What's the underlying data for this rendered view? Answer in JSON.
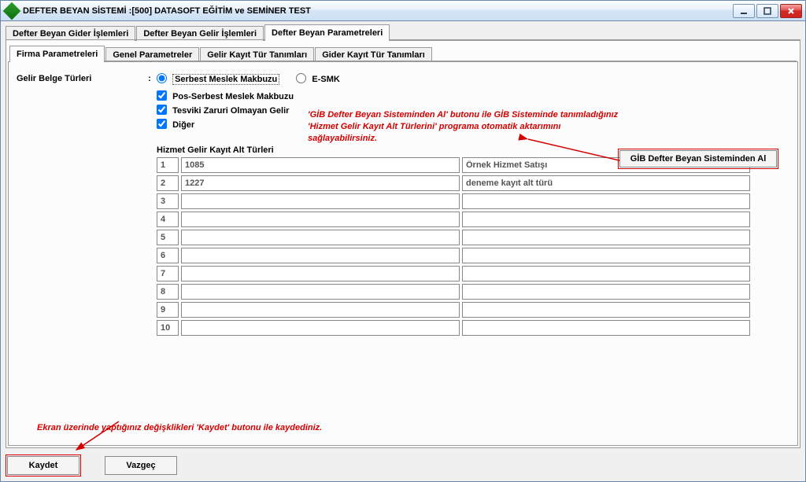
{
  "window": {
    "title": "DEFTER BEYAN SİSTEMİ  :[500]  DATASOFT EĞİTİM ve SEMİNER TEST"
  },
  "topTabs": {
    "items": [
      {
        "label": "Defter Beyan Gider İşlemleri"
      },
      {
        "label": "Defter Beyan Gelir İşlemleri"
      },
      {
        "label": "Defter Beyan Parametreleri"
      }
    ]
  },
  "innerTabs": {
    "items": [
      {
        "label": "Firma Parametreleri"
      },
      {
        "label": "Genel Parametreler"
      },
      {
        "label": "Gelir Kayıt Tür Tanımları"
      },
      {
        "label": "Gider Kayıt Tür Tanımları"
      }
    ]
  },
  "form": {
    "belgeTurLabel": "Gelir Belge Türleri",
    "radio": {
      "serbest": "Serbest Meslek Makbuzu",
      "esmk": "E-SMK"
    },
    "chk": {
      "pos": "Pos-Serbest Meslek Makbuzu",
      "tesvik": "Tesviki Zaruri Olmayan Gelir",
      "diger": "Diğer"
    },
    "subheading": "Hizmet Gelir Kayıt Alt Türleri",
    "gibBtn": "GİB Defter Beyan Sisteminden Al",
    "rows": [
      {
        "idx": "1",
        "code": "1085",
        "desc": "Örnek Hizmet Satışı"
      },
      {
        "idx": "2",
        "code": "1227",
        "desc": "deneme kayıt alt türü"
      },
      {
        "idx": "3",
        "code": "",
        "desc": ""
      },
      {
        "idx": "4",
        "code": "",
        "desc": ""
      },
      {
        "idx": "5",
        "code": "",
        "desc": ""
      },
      {
        "idx": "6",
        "code": "",
        "desc": ""
      },
      {
        "idx": "7",
        "code": "",
        "desc": ""
      },
      {
        "idx": "8",
        "code": "",
        "desc": ""
      },
      {
        "idx": "9",
        "code": "",
        "desc": ""
      },
      {
        "idx": "10",
        "code": "",
        "desc": ""
      }
    ]
  },
  "annotations": {
    "top": "'GİB Defter Beyan Sisteminden Al' butonu ile GİB Sisteminde tanımladığınız  'Hizmet Gelir Kayıt Alt Türlerini' programa otomatik aktarımını sağlayabilirsiniz.",
    "bottom": "Ekran üzerinde yaptığınız değişklikleri 'Kaydet' butonu ile kaydediniz."
  },
  "footer": {
    "save": "Kaydet",
    "cancel": "Vazgeç"
  }
}
